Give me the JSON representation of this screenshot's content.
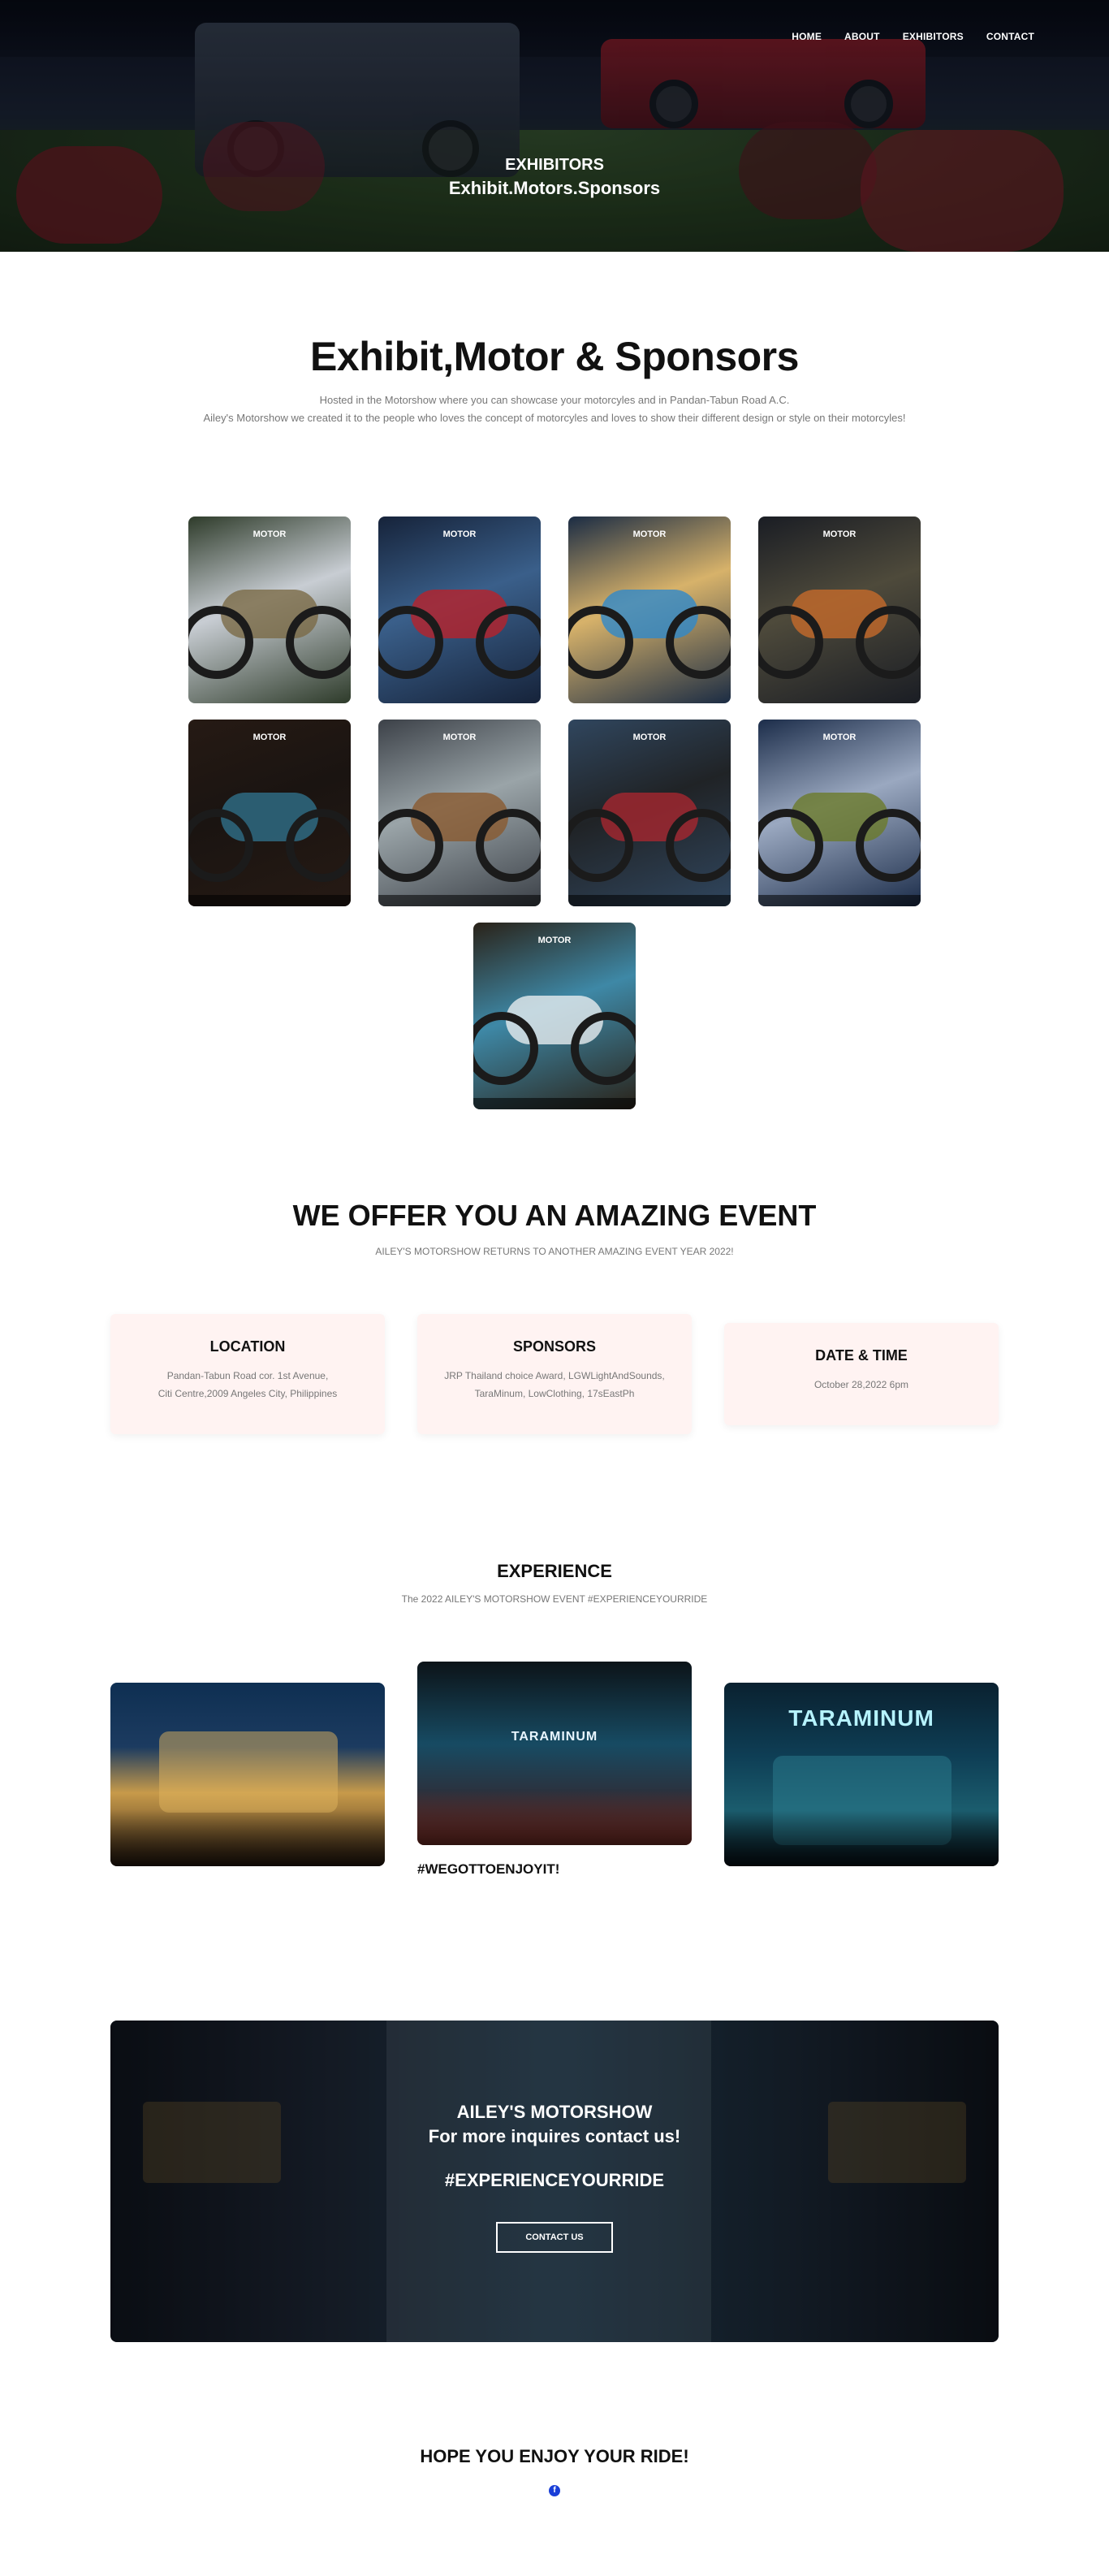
{
  "nav": {
    "items": [
      {
        "label": "HOME"
      },
      {
        "label": "ABOUT"
      },
      {
        "label": "EXHIBITORS"
      },
      {
        "label": "CONTACT"
      }
    ]
  },
  "hero": {
    "title": "EXHIBITORS",
    "subtitle": "Exhibit.Motors.Sponsors"
  },
  "intro": {
    "heading": "Exhibit,Motor & Sponsors",
    "line1": "Hosted in the Motorshow where you can showcase your motorcyles and in Pandan-Tabun Road A.C.",
    "line2": "Ailey's Motorshow we created it to the people who loves the concept of motorcyles and loves to show their different design or style on their motorcyles!"
  },
  "gallery": {
    "cards": [
      {
        "label": "MOTOR",
        "colors": [
          "#2e3b2a",
          "#7b6a46",
          "#c8cdd3"
        ]
      },
      {
        "label": "MOTOR",
        "colors": [
          "#16233a",
          "#b8222b",
          "#3a5f8a"
        ]
      },
      {
        "label": "MOTOR",
        "colors": [
          "#1b2c44",
          "#2f88c9",
          "#d7b26a"
        ]
      },
      {
        "label": "MOTOR",
        "colors": [
          "#1a1d24",
          "#c56a2a",
          "#4e4a3b"
        ]
      },
      {
        "label": "MOTOR",
        "colors": [
          "#261a14",
          "#2f6f8a",
          "#1a1411"
        ]
      },
      {
        "label": "MOTOR",
        "colors": [
          "#3c4148",
          "#8a5a30",
          "#9aa4a8"
        ]
      },
      {
        "label": "MOTOR",
        "colors": [
          "#30465e",
          "#a62730",
          "#202326"
        ]
      },
      {
        "label": "MOTOR",
        "colors": [
          "#1c2d4a",
          "#6c7a2a",
          "#9aa8c0"
        ]
      },
      {
        "label": "MOTOR",
        "colors": [
          "#2a2218",
          "#e7ecef",
          "#3e88a6"
        ]
      }
    ]
  },
  "offer": {
    "heading": "WE OFFER YOU AN AMAZING EVENT",
    "sub": "AILEY'S MOTORSHOW RETURNS TO ANOTHER AMAZING EVENT YEAR 2022!",
    "boxes": [
      {
        "title": "LOCATION",
        "line1": "Pandan-Tabun Road cor. 1st Avenue,",
        "line2": "Citi Centre,2009 Angeles City, Philippines"
      },
      {
        "title": "SPONSORS",
        "line1": "JRP Thailand choice Award, LGWLightAndSounds,",
        "line2": "TaraMinum, LowClothing, 17sEastPh"
      },
      {
        "title": "DATE & TIME",
        "line1": "October 28,2022 6pm"
      }
    ]
  },
  "experience": {
    "heading": "EXPERIENCE",
    "sub": "The 2022 AILEY'S MOTORSHOW EVENT #EXPERIENCEYOURRIDE",
    "caption": "#WEGOTTOENJOYIT!",
    "signs": [
      "TARAMINUM",
      "TARAMINUM"
    ]
  },
  "banner": {
    "line1": "AILEY'S MOTORSHOW",
    "line2": "For more inquires contact us!",
    "hashtag": "#EXPERIENCEYOURRIDE",
    "button": "CONTACT US"
  },
  "footer": {
    "heading": "HOPE YOU ENJOY YOUR RIDE!",
    "social_icon": "facebook-icon",
    "social_glyph": "f"
  }
}
